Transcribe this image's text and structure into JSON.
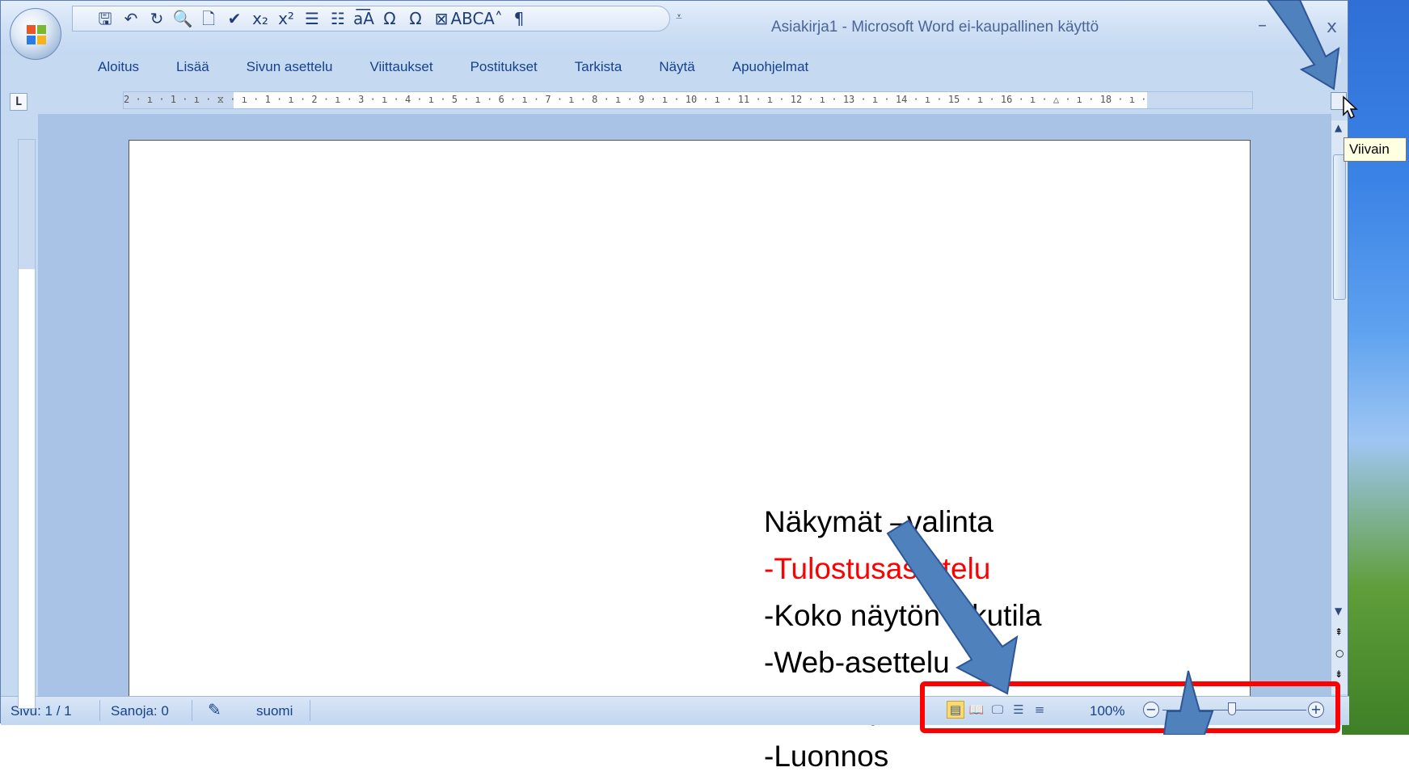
{
  "window": {
    "title": "Asiakirja1 - Microsoft Word ei-kaupallinen käyttö",
    "minimize_glyph": "–",
    "close_glyph": "x"
  },
  "quick_access": {
    "buttons": [
      {
        "name": "save-icon",
        "glyph": "🖫"
      },
      {
        "name": "undo-icon",
        "glyph": "↶"
      },
      {
        "name": "redo-icon",
        "glyph": "↻"
      },
      {
        "name": "print-preview-icon",
        "glyph": "🔍"
      },
      {
        "name": "new-document-icon",
        "glyph": "🗋"
      },
      {
        "name": "spelling-icon",
        "glyph": "✔"
      },
      {
        "name": "subscript-icon",
        "glyph": "x₂"
      },
      {
        "name": "superscript-icon",
        "glyph": "x²"
      },
      {
        "name": "bullets-icon",
        "glyph": "☰"
      },
      {
        "name": "numbering-icon",
        "glyph": "☷"
      },
      {
        "name": "change-case-icon",
        "glyph": "a͞A"
      },
      {
        "name": "symbol-icon",
        "glyph": "Ω"
      },
      {
        "name": "insert-symbol-icon",
        "glyph": "Ω"
      },
      {
        "name": "insert-object-icon",
        "glyph": "⊠"
      },
      {
        "name": "word-count-icon",
        "glyph": "ABC"
      },
      {
        "name": "grow-font-icon",
        "glyph": "A˄"
      },
      {
        "name": "show-formatting-icon",
        "glyph": "¶"
      }
    ],
    "more_glyph": "⩡"
  },
  "ribbon": {
    "tabs": [
      "Aloitus",
      "Lisää",
      "Sivun asettelu",
      "Viittaukset",
      "Postitukset",
      "Tarkista",
      "Näytä",
      "Apuohjelmat"
    ]
  },
  "ruler": {
    "tab_selector": "L",
    "numbers": "2 · ı · 1 · ı · ⧖ · ı · 1 · ı · 2 · ı · 3 · ı · 4 · ı · 5 · ı · 6 · ı · 7 · ı · 8 · ı · 9 · ı · 10 · ı · 11 · ı · 12 · ı · 13 · ı · 14 · ı · 15 · ı · 16 · ı · △ · ı · 18 · ı ·"
  },
  "tooltip": {
    "text": "Viivain"
  },
  "document": {
    "lines": [
      {
        "text": "Näkymät –valinta",
        "color": "#000000"
      },
      {
        "text": "-Tulostusasettelu",
        "color": "#ff0000"
      },
      {
        "text": "-Koko näytön lukutila",
        "color": "#000000"
      },
      {
        "text": "-Web-asettelu",
        "color": "#000000"
      },
      {
        "text": "-Jäsennys",
        "color": "#000000"
      },
      {
        "text": "-Luonnos",
        "color": "#000000"
      }
    ]
  },
  "statusbar": {
    "page": "Sivu: 1 / 1",
    "words": "Sanoja: 0",
    "language": "suomi",
    "zoom": "100%",
    "zoom_level_percent": 100,
    "views": [
      {
        "name": "print-layout-view-button",
        "glyph": "▤",
        "active": true
      },
      {
        "name": "full-screen-reading-view-button",
        "glyph": "📖",
        "active": false
      },
      {
        "name": "web-layout-view-button",
        "glyph": "🖵",
        "active": false
      },
      {
        "name": "outline-view-button",
        "glyph": "☰",
        "active": false
      },
      {
        "name": "draft-view-button",
        "glyph": "≡",
        "active": false
      }
    ],
    "zoom_out": "−",
    "zoom_in": "+"
  },
  "annotation": {
    "arrow_color": "#4f81bd",
    "highlight_color": "#ff0000"
  }
}
